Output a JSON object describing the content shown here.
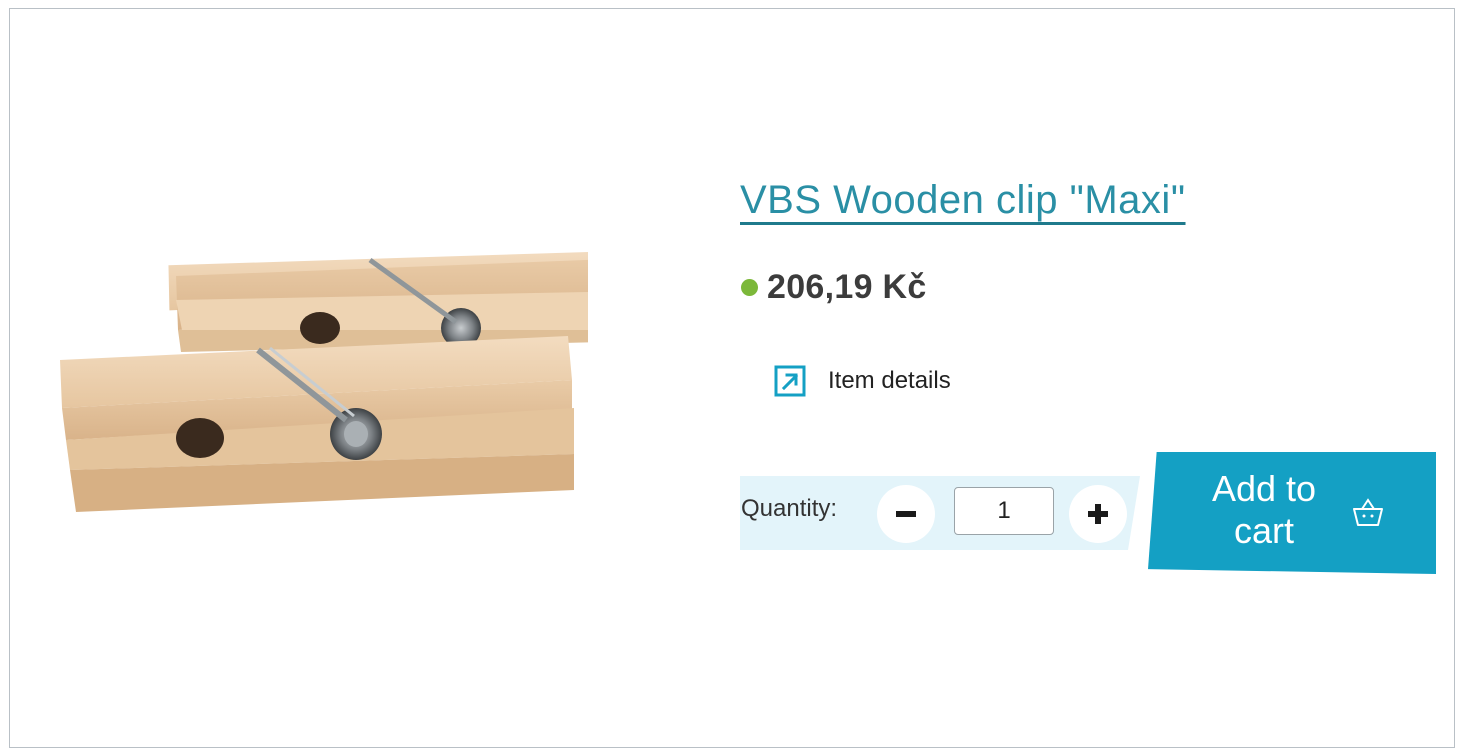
{
  "product": {
    "title": "VBS Wooden clip \"Maxi\"",
    "price": "206,19 Kč",
    "availability_color": "#7cb83a",
    "image_icon": "wooden-clothespin-image"
  },
  "details": {
    "label": "Item details",
    "icon": "external-link-icon"
  },
  "quantity": {
    "label": "Quantity:",
    "value": "1",
    "minus_icon": "minus-icon",
    "plus_icon": "plus-icon"
  },
  "cart": {
    "label": "Add to cart",
    "icon": "basket-icon",
    "color": "#14a0c4"
  },
  "colors": {
    "title": "#2a8fa5",
    "qty_background": "#e3f4fa"
  }
}
